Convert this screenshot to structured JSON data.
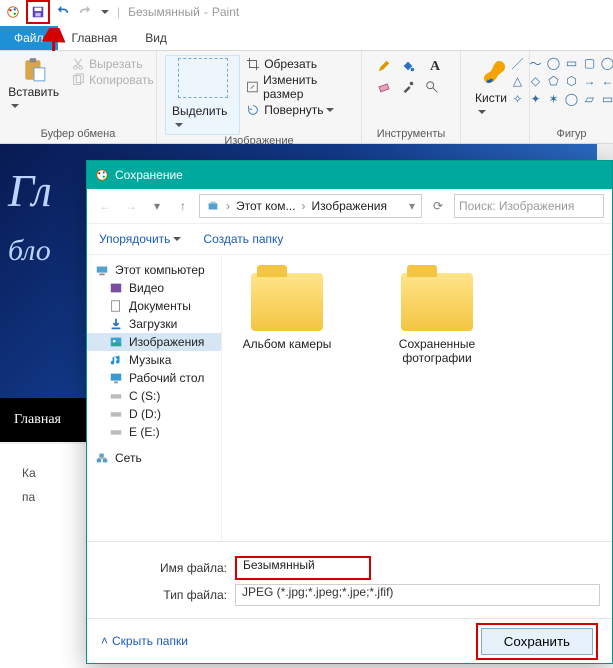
{
  "window": {
    "title_doc": "Безымянный",
    "title_app": "Paint"
  },
  "tabs": {
    "file": "Файл",
    "home": "Главная",
    "view": "Вид"
  },
  "ribbon": {
    "clipboard": {
      "paste": "Вставить",
      "cut": "Вырезать",
      "copy": "Копировать",
      "title": "Буфер обмена"
    },
    "image": {
      "select": "Выделить",
      "crop": "Обрезать",
      "resize": "Изменить размер",
      "rotate": "Повернуть",
      "title": "Изображение"
    },
    "tools": {
      "title": "Инструменты"
    },
    "brushes": {
      "label": "Кисти"
    },
    "shapes": {
      "title": "Фигур"
    }
  },
  "canvas": {
    "big": "Гл",
    "small": "бло",
    "nav": "Главная",
    "below1": "Ка",
    "below2": "па"
  },
  "dialog": {
    "title": "Сохранение",
    "path": {
      "root": "Этот ком...",
      "folder": "Изображения"
    },
    "search_placeholder": "Поиск: Изображения",
    "cmd_organize": "Упорядочить",
    "cmd_newfolder": "Создать папку",
    "tree": {
      "pc": "Этот компьютер",
      "video": "Видео",
      "docs": "Документы",
      "downloads": "Загрузки",
      "pictures": "Изображения",
      "music": "Музыка",
      "desktop": "Рабочий стол",
      "c": "C (S:)",
      "d": "D (D:)",
      "e": "E (E:)",
      "net": "Сеть"
    },
    "folders": {
      "f1": "Альбом камеры",
      "f2": "Сохраненные фотографии"
    },
    "filename_label": "Имя файла:",
    "filename_value": "Безымянный",
    "filetype_label": "Тип файла:",
    "filetype_value": "JPEG (*.jpg;*.jpeg;*.jpe;*.jfif)",
    "hide": "Скрыть папки",
    "save": "Сохранить"
  }
}
